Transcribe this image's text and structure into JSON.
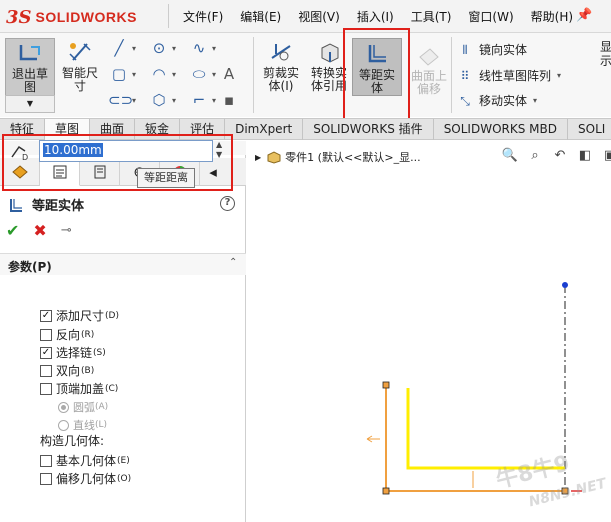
{
  "app": {
    "brand_ds": "3S",
    "brand_name": "SOLIDWORKS"
  },
  "menu": [
    {
      "label": "文件(F)"
    },
    {
      "label": "编辑(E)"
    },
    {
      "label": "视图(V)"
    },
    {
      "label": "插入(I)"
    },
    {
      "label": "工具(T)"
    },
    {
      "label": "窗口(W)"
    },
    {
      "label": "帮助(H)"
    }
  ],
  "ribbon": {
    "exit_sketch": "退出草\n图",
    "smart_dim": "智能尺\n寸",
    "trim": "剪裁实\n体(I)",
    "convert": "转换实\n体引用",
    "offset": "等距实\n体",
    "surface_offset": "曲面上\n偏移",
    "mirror": "镜向实体",
    "linear_pattern": "线性草图阵列",
    "move": "移动实体",
    "more": "显\n示"
  },
  "tabs": [
    {
      "label": "特征"
    },
    {
      "label": "草图"
    },
    {
      "label": "曲面"
    },
    {
      "label": "钣金"
    },
    {
      "label": "评估"
    },
    {
      "label": "DimXpert"
    },
    {
      "label": "SOLIDWORKS 插件"
    },
    {
      "label": "SOLIDWORKS MBD"
    },
    {
      "label": "SOLI"
    }
  ],
  "active_tab_index": 1,
  "property_manager": {
    "title": "等距实体",
    "help": "?",
    "group_title": "参数(P)",
    "distance_value": "10.00mm",
    "tooltip": "等距距离",
    "options": [
      {
        "label": "添加尺寸",
        "suffix": "(D)",
        "checked": true
      },
      {
        "label": "反向",
        "suffix": "(R)",
        "checked": false
      },
      {
        "label": "选择链",
        "suffix": "(S)",
        "checked": true
      },
      {
        "label": "双向",
        "suffix": "(B)",
        "checked": false
      },
      {
        "label": "顶端加盖",
        "suffix": "(C)",
        "checked": false
      }
    ],
    "cap_options": [
      {
        "label": "圆弧",
        "suffix": "(A)",
        "selected": true
      },
      {
        "label": "直线",
        "suffix": "(L)",
        "selected": false
      }
    ],
    "construct_label": "构造几何体:",
    "construct_options": [
      {
        "label": "基本几何体",
        "suffix": "(E)",
        "checked": false
      },
      {
        "label": "偏移几何体",
        "suffix": "(O)",
        "checked": false
      }
    ]
  },
  "graphics": {
    "tree_text": "零件1  (默认<<默认>_显..."
  },
  "watermark": {
    "line1": "牛8牛9",
    "line2": "N8N9.NET"
  },
  "colors": {
    "accent_red": "#e0201a",
    "sketch_yellow": "#ffee00",
    "sketch_orange": "#f0a040"
  }
}
